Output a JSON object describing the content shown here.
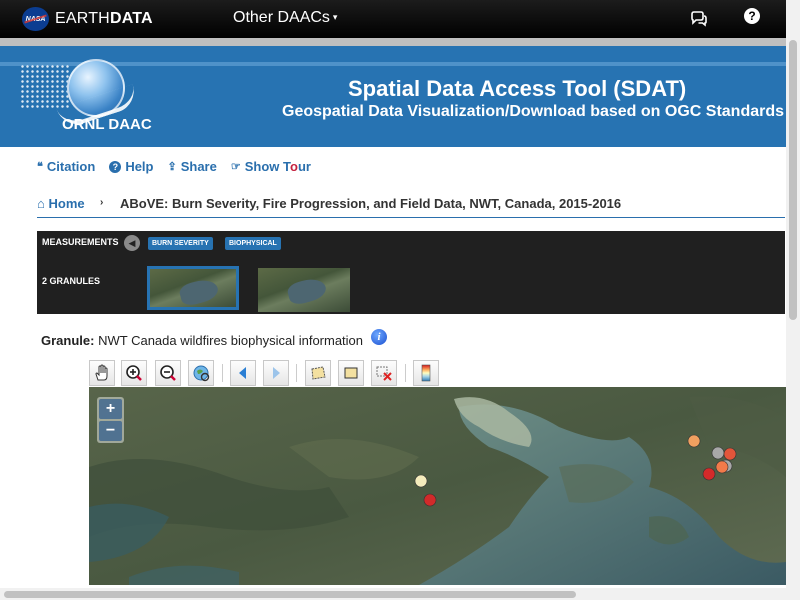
{
  "topnav": {
    "nasa_logo_text": "NASA",
    "brand_prefix": "EARTH",
    "brand_bold": "DATA",
    "other_daacs": "Other DAACs",
    "other_daacs_caret": "▾",
    "help_symbol": "?",
    "icons": [
      "nasa-logo",
      "chat-icon",
      "help-icon"
    ]
  },
  "banner": {
    "logo_text": "ORNL DAAC",
    "title": "Spatial Data Access Tool (SDAT)",
    "subtitle": "Geospatial Data Visualization/Download based on OGC Standards",
    "background_color": "#2773b2"
  },
  "links": [
    {
      "label": "Citation",
      "icon": "quote-icon",
      "glyph": "❝"
    },
    {
      "label": "Help",
      "icon": "question-circle-icon",
      "glyph": "?"
    },
    {
      "label": "Share",
      "icon": "share-icon",
      "glyph": "⇪"
    },
    {
      "label_a": "Show T",
      "label_o": "o",
      "label_b": "ur",
      "icon": "pointer-icon",
      "glyph": "☞"
    }
  ],
  "breadcrumb": {
    "home_icon_glyph": "⌂",
    "home": "Home",
    "separator": "›",
    "current": "ABoVE: Burn Severity, Fire Progression, and Field Data, NWT, Canada, 2015-2016"
  },
  "measurements": {
    "label": "MEASUREMENTS",
    "back_glyph": "◀",
    "tags": [
      "BURN SEVERITY",
      "BIOPHYSICAL"
    ],
    "granules_label": "2 GRANULES",
    "selected_granule_index": 0
  },
  "granule": {
    "label": "Granule:",
    "name": "NWT Canada wildfires biophysical information",
    "info_glyph": "i"
  },
  "toolbar": {
    "tools": [
      "pan-hand-icon",
      "zoom-in-icon",
      "zoom-out-icon",
      "full-extent-icon",
      "previous-extent-icon",
      "next-extent-icon",
      "select-polygon-icon",
      "select-box-icon",
      "clear-selection-icon",
      "color-ramp-icon"
    ]
  },
  "map": {
    "zoom_in": "+",
    "zoom_out": "−",
    "point_colors": [
      "#f4ecbc",
      "#d12a2a",
      "#f0a060",
      "#a8a8a8",
      "#e2553a",
      "#d42a2a",
      "#f27a4a"
    ]
  }
}
